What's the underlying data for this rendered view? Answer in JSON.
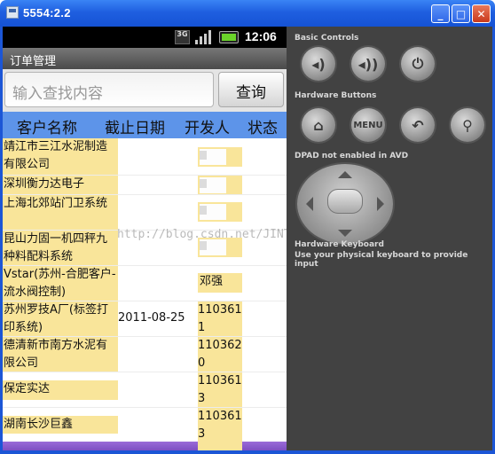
{
  "window": {
    "title": "5554:2.2",
    "minimize_label": "_",
    "maximize_label": "□",
    "close_label": "✕"
  },
  "status_bar": {
    "network": "3G",
    "time": "12:06"
  },
  "app": {
    "title": "订单管理"
  },
  "search": {
    "placeholder": "输入查找内容",
    "button_label": "查询"
  },
  "table": {
    "headers": [
      "客户名称",
      "截止日期",
      "开发人",
      "状态"
    ],
    "rows": [
      {
        "name": "靖江市三江水泥制造有限公司",
        "date": "",
        "developer": ""
      },
      {
        "name": "深圳衡力达电子",
        "date": "",
        "developer": ""
      },
      {
        "name": "上海北郊站门卫系统",
        "date": "",
        "developer": ""
      },
      {
        "name": "昆山力固一机四秤九种料配料系统",
        "date": "",
        "developer": ""
      },
      {
        "name": "Vstar(苏州-合肥客户-流水阀控制)",
        "date": "",
        "developer": "邓强"
      },
      {
        "name": "苏州罗技A厂(标签打印系统)",
        "date": "2011-08-25",
        "developer": "1103611"
      },
      {
        "name": "德清新市南方水泥有限公司",
        "date": "",
        "developer": "1103620"
      },
      {
        "name": "保定实达",
        "date": "",
        "developer": "1103613"
      },
      {
        "name": "湖南长沙巨鑫",
        "date": "",
        "developer": "1103613"
      }
    ]
  },
  "watermark": "http://blog.csdn.net/JINTIANBUXIAYU1",
  "controls": {
    "basic_controls": "Basic Controls",
    "hardware_buttons": "Hardware Buttons",
    "menu_label": "MENU",
    "dpad_label": "DPAD not enabled in AVD",
    "keyboard_title": "Hardware Keyboard",
    "keyboard_desc": "Use your physical keyboard to provide input"
  }
}
